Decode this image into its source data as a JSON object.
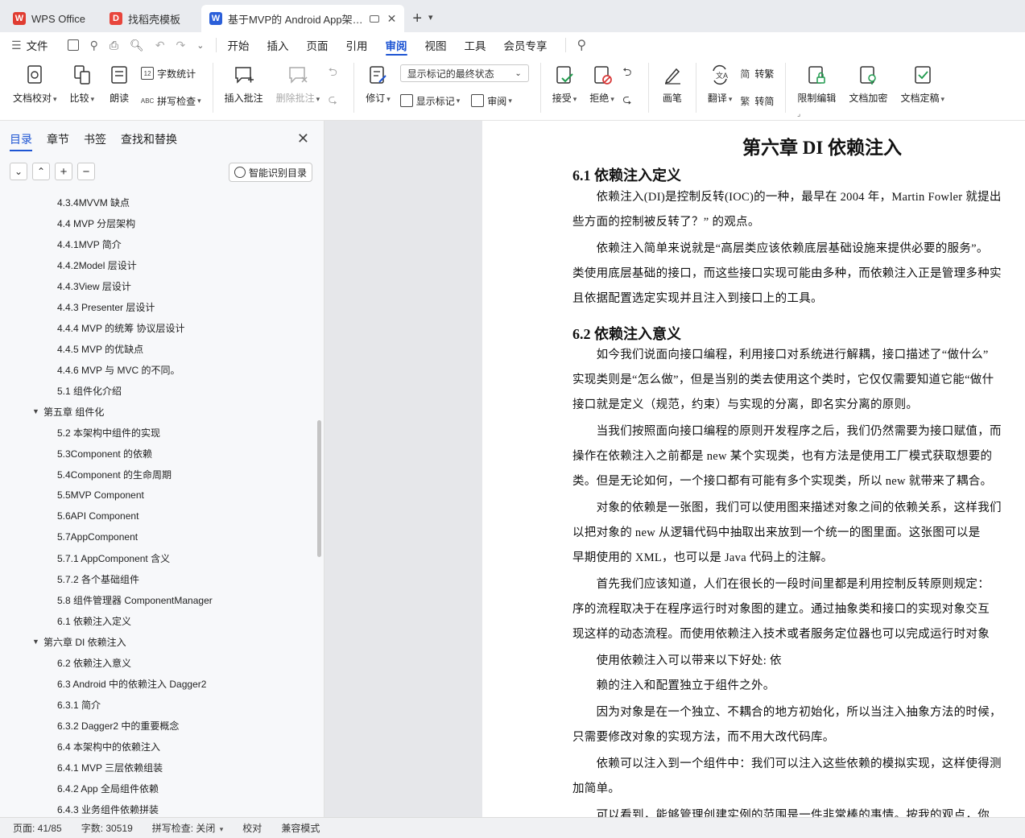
{
  "tabs": [
    {
      "label": "WPS Office",
      "logo": "W",
      "logo_color": "#e03c31"
    },
    {
      "label": "找稻壳模板",
      "logo": "D",
      "logo_color": "#e8453c"
    },
    {
      "label": "基于MVP的 Android App架…",
      "logo": "W",
      "logo_color": "#2b5fd9"
    }
  ],
  "menu": {
    "file": "文件",
    "items": [
      "开始",
      "插入",
      "页面",
      "引用",
      "审阅",
      "视图",
      "工具",
      "会员专享"
    ],
    "active": "审阅"
  },
  "ribbon": {
    "doc_check": "文档校对",
    "compare": "比较",
    "read_aloud": "朗读",
    "word_count": "字数统计",
    "spell_check": "拼写检查",
    "insert_comment": "插入批注",
    "delete_comment": "删除批注",
    "revise": "修订",
    "markup_select": "显示标记的最终状态",
    "show_markup": "显示标记",
    "review": "审阅",
    "accept": "接受",
    "reject": "拒绝",
    "pen": "画笔",
    "translate": "翻译",
    "to_traditional": "转繁",
    "to_simplified": "转简",
    "restrict_edit": "限制编辑",
    "encrypt": "文档加密",
    "finalize": "文档定稿"
  },
  "sidebar": {
    "tabs": [
      "目录",
      "章节",
      "书签",
      "查找和替换"
    ],
    "smart_toc": "智能识别目录",
    "toc": [
      {
        "level": 2,
        "text": "4.3.4MVVM 缺点"
      },
      {
        "level": 2,
        "text": "4.4 MVP 分层架构"
      },
      {
        "level": 2,
        "text": "4.4.1MVP 简介"
      },
      {
        "level": 2,
        "text": "4.4.2Model 层设计"
      },
      {
        "level": 2,
        "text": "4.4.3View  层设计"
      },
      {
        "level": 2,
        "text": "4.4.3 Presenter 层设计"
      },
      {
        "level": 2,
        "text": "4.4.4 MVP  的统筹 协议层设计"
      },
      {
        "level": 2,
        "text": "4.4.5 MVP 的优缺点"
      },
      {
        "level": 2,
        "text": "4.4.6 MVP  与 MVC 的不同。"
      },
      {
        "level": 2,
        "text": "5.1 组件化介绍"
      },
      {
        "level": 1,
        "text": "第五章 组件化"
      },
      {
        "level": 2,
        "text": "5.2 本架构中组件的实现"
      },
      {
        "level": 2,
        "text": "5.3Component 的依赖"
      },
      {
        "level": 2,
        "text": "5.4Component 的生命周期"
      },
      {
        "level": 2,
        "text": "5.5MVP Component"
      },
      {
        "level": 2,
        "text": "5.6API Component"
      },
      {
        "level": 2,
        "text": "5.7AppComponent"
      },
      {
        "level": 2,
        "text": "5.7.1 AppComponent 含义"
      },
      {
        "level": 2,
        "text": "5.7.2 各个基础组件"
      },
      {
        "level": 2,
        "text": "5.8  组件管理器 ComponentManager"
      },
      {
        "level": 2,
        "text": "6.1 依赖注入定义"
      },
      {
        "level": 1,
        "text": "第六章 DI 依赖注入"
      },
      {
        "level": 2,
        "text": "6.2 依赖注入意义"
      },
      {
        "level": 2,
        "text": "6.3 Android  中的依赖注入 Dagger2"
      },
      {
        "level": 2,
        "text": "6.3.1 简介"
      },
      {
        "level": 2,
        "text": "6.3.2 Dagger2  中的重要概念"
      },
      {
        "level": 2,
        "text": "6.4 本架构中的依赖注入"
      },
      {
        "level": 2,
        "text": "6.4.1 MVP 三层依赖组装"
      },
      {
        "level": 2,
        "text": "6.4.2 App 全局组件依赖"
      },
      {
        "level": 2,
        "text": "6.4.3 业务组件依赖拼装"
      }
    ]
  },
  "document": {
    "chapter_title": "第六章  DI  依赖注入",
    "sec1": "6.1  依赖注入定义",
    "sec2": "6.2  依赖注入意义",
    "lines1": [
      "　　依赖注入(DI)是控制反转(IOC)的一种，最早在  2004 年，Martin Fowler 就提出",
      "些方面的控制被反转了？”  的观点。",
      "　　依赖注入简单来说就是“高层类应该依赖底层基础设施来提供必要的服务”。",
      "类使用底层基础的接口，而这些接口实现可能由多种，而依赖注入正是管理多种实",
      "且依据配置选定实现并且注入到接口上的工具。"
    ],
    "lines2": [
      "　　如今我们说面向接口编程，利用接口对系统进行解耦，接口描述了“做什么”",
      "实现类则是“怎么做”，但是当别的类去使用这个类时，它仅仅需要知道它能“做什",
      "接口就是定义（规范，约束）与实现的分离，即名实分离的原则。",
      "　　当我们按照面向接口编程的原则开发程序之后，我们仍然需要为接口赋值，而",
      "操作在依赖注入之前都是  new 某个实现类，也有方法是使用工厂模式获取想要的",
      "类。但是无论如何，一个接口都有可能有多个实现类，所以  new  就带来了耦合。",
      "　　对象的依赖是一张图，我们可以使用图来描述对象之间的依赖关系，这样我们",
      "以把对象的  new 从逻辑代码中抽取出来放到一个统一的图里面。这张图可以是",
      "早期使用的  XML，也可以是  Java  代码上的注解。",
      "　　首先我们应该知道，人们在很长的一段时间里都是利用控制反转原则规定：",
      "序的流程取决于在程序运行时对象图的建立。通过抽象类和接口的实现对象交互",
      "现这样的动态流程。而使用依赖注入技术或者服务定位器也可以完成运行时对象",
      "　　使用依赖注入可以带来以下好处: 依",
      "　　赖的注入和配置独立于组件之外。",
      "　　因为对象是在一个独立、不耦合的地方初始化，所以当注入抽象方法的时候，",
      "只需要修改对象的实现方法，而不用大改代码库。",
      "　　依赖可以注入到一个组件中：我们可以注入这些依赖的模拟实现，这样使得测",
      "加简单。",
      "　　可以看到，能够管理创建实例的范围是一件非常棒的事情。按我的观点，你"
    ]
  },
  "status": {
    "page": "页面: 41/85",
    "words": "字数: 30519",
    "spell": "拼写检查: 关闭",
    "proof": "校对",
    "compat": "兼容模式"
  },
  "colors": {
    "accent": "#1e55d3"
  }
}
